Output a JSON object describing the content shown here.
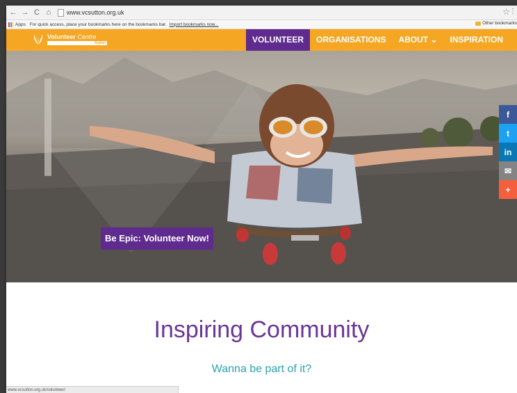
{
  "browser": {
    "url": "www.vcsutton.org.uk",
    "bookmarks": {
      "apps_label": "Apps",
      "hint_text": "For quick access, place your bookmarks here on the bookmarks bar.",
      "import_link": "Import bookmarks now...",
      "other_label": "Other bookmarks"
    },
    "status_url": "www.vcsutton.org.uk/volunteer/"
  },
  "site": {
    "logo": {
      "name_part1": "Volunteer",
      "name_part2": "Centre",
      "sub": "Sutton"
    },
    "nav": [
      {
        "label": "VOLUNTEER"
      },
      {
        "label": "ORGANISATIONS"
      },
      {
        "label": "ABOUT ⌄"
      },
      {
        "label": "INSPIRATION"
      }
    ],
    "brand_colors": {
      "orange": "#f5a623",
      "purple": "#5f2b8e",
      "teal": "#2aa1ad"
    }
  },
  "hero": {
    "cta_label": "Be Epic: Volunteer Now!"
  },
  "share": [
    {
      "label": "f",
      "icon": "facebook-icon",
      "color": "#3b5998"
    },
    {
      "label": "t",
      "icon": "twitter-icon",
      "color": "#1da1f2"
    },
    {
      "label": "in",
      "icon": "linkedin-icon",
      "color": "#0a77b5"
    },
    {
      "label": "✉",
      "icon": "email-icon",
      "color": "#848484"
    },
    {
      "label": "+",
      "icon": "more-share-icon",
      "color": "#f4603e"
    }
  ],
  "content": {
    "headline": "Inspiring Community",
    "subline": "Wanna be part of it?"
  }
}
